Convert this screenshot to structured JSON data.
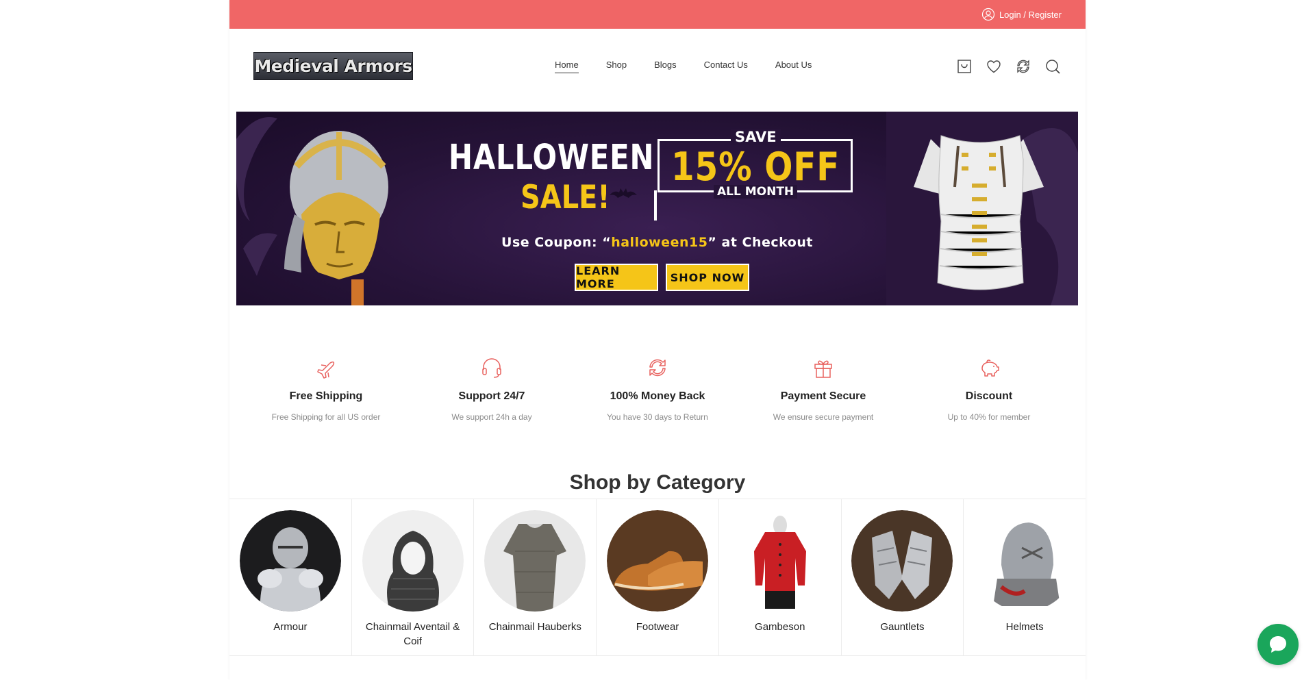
{
  "topbar": {
    "login_label": "Login / Register"
  },
  "header": {
    "logo_text": "Medieval Armors",
    "nav": [
      "Home",
      "Shop",
      "Blogs",
      "Contact Us",
      "About Us"
    ],
    "active_nav": "Home"
  },
  "banner": {
    "headline": "HALLOWEEN",
    "subheadline": "SALE!",
    "save_label": "SAVE",
    "offer": "15% OFF",
    "period": "ALL MONTH",
    "coupon_prefix": "Use Coupon: “",
    "coupon_code": "halloween15",
    "coupon_suffix": "” at Checkout",
    "learn_more": "LEARN MORE",
    "shop_now": "SHOP NOW"
  },
  "features": [
    {
      "icon": "airplane-icon",
      "title": "Free Shipping",
      "desc": "Free Shipping for all US order"
    },
    {
      "icon": "headset-icon",
      "title": "Support 24/7",
      "desc": "We support 24h a day"
    },
    {
      "icon": "refresh-icon",
      "title": "100% Money Back",
      "desc": "You have 30 days to Return"
    },
    {
      "icon": "gift-icon",
      "title": "Payment Secure",
      "desc": "We ensure secure payment"
    },
    {
      "icon": "piggy-bank-icon",
      "title": "Discount",
      "desc": "Up to 40% for member"
    }
  ],
  "categories_section": {
    "title": "Shop by Category",
    "items": [
      "Armour",
      "Chainmail Aventail & Coif",
      "Chainmail Hauberks",
      "Footwear",
      "Gambeson",
      "Gauntlets",
      "Helmets"
    ]
  },
  "colors": {
    "topbar": "#f06666",
    "accent": "#f5c518",
    "banner_bg": "#261338",
    "chat": "#1aa65b",
    "icon_accent": "#e8625f"
  }
}
